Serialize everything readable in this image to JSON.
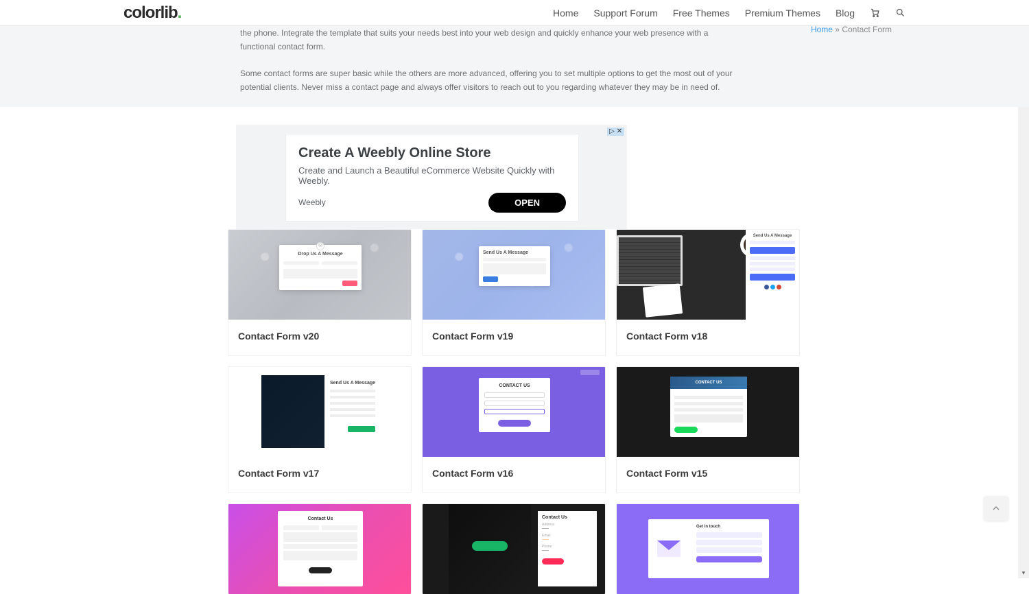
{
  "header": {
    "logo_main": "colorlib",
    "logo_dot": ".",
    "nav": {
      "home": "Home",
      "support": "Support Forum",
      "free": "Free Themes",
      "premium": "Premium Themes",
      "blog": "Blog"
    }
  },
  "breadcrumb": {
    "home": "Home",
    "sep": " » ",
    "current": "Contact Form"
  },
  "intro": {
    "p1_fragment": "the phone. Integrate the template that suits your needs best into your web design and quickly enhance your web presence with a functional contact form.",
    "p2": "Some contact forms are super basic while the others are more advanced, offering you to set multiple options to get the most out of your potential clients. Never miss a contact page and always offer visitors to reach out to you regarding whatever they may be in need of."
  },
  "ad": {
    "title": "Create A Weebly Online Store",
    "subtitle": "Create and Launch a Beautiful eCommerce Website Quickly with Weebly.",
    "brand": "Weebly",
    "cta": "OPEN"
  },
  "cards": {
    "c20": "Contact Form v20",
    "c19": "Contact Form v19",
    "c18": "Contact Form v18",
    "c17": "Contact Form v17",
    "c16": "Contact Form v16",
    "c15": "Contact Form v15"
  },
  "thumb_text": {
    "drop_msg": "Drop Us A Message",
    "send_msg": "Send Us A Message",
    "send_msg2": "Send Us A Message",
    "contact_us": "CONTACT US",
    "contact_us2": "Contact Us",
    "get_in_touch": "Get in touch"
  }
}
